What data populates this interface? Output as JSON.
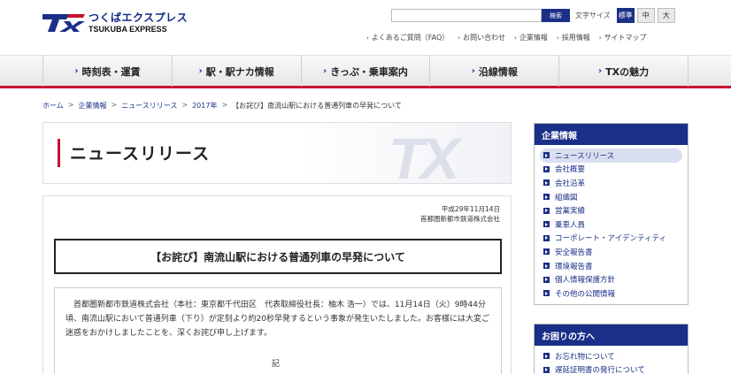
{
  "header": {
    "logo_jp": "つくばエクスプレス",
    "logo_en": "TSUKUBA EXPRESS",
    "search_placeholder": "",
    "search_button": "検索",
    "fontsize_label": "文字サイズ",
    "fontsize_options": [
      "標準",
      "中",
      "大"
    ],
    "util_links": [
      "よくあるご質問（FAQ）",
      "お問い合わせ",
      "企業情報",
      "採用情報",
      "サイトマップ"
    ]
  },
  "gnav": [
    "時刻表・運賃",
    "駅・駅ナカ情報",
    "きっぷ・乗車案内",
    "沿線情報",
    "TXの魅力"
  ],
  "breadcrumb": [
    "ホーム",
    "企業情報",
    "ニュースリリース",
    "2017年"
  ],
  "breadcrumb_current": "【お詫び】南流山駅における普通列車の早発について",
  "page_title": "ニュースリリース",
  "watermark": "TX",
  "article": {
    "date": "平成29年11月14日",
    "company": "首都圏新都市鉄道株式会社",
    "title": "【お詫び】南流山駅における普通列車の早発について",
    "body": "首都圏新都市鉄道株式会社（本社：東京都千代田区　代表取締役社長：柚木 浩一）では、11月14日（火）9時44分頃、南流山駅において普通列車（下り）が定刻より約20秒早発するという事象が発生いたしました。お客様には大変ご迷惑をおかけしましたことを、深くお詫び申し上げます。",
    "ki": "記"
  },
  "sidebar": {
    "corporate": {
      "heading": "企業情報",
      "items": [
        "ニュースリリース",
        "会社概要",
        "会社沿革",
        "組織図",
        "営業実績",
        "乗車人員",
        "コーポレート・アイデンティティ",
        "安全報告書",
        "環境報告書",
        "個人情報保護方針",
        "その他の公開情報"
      ]
    },
    "help": {
      "heading": "お困りの方へ",
      "items": [
        "お忘れ物について",
        "遅延証明書の発行について"
      ]
    }
  },
  "colors": {
    "brand_navy": "#1a2f87",
    "accent_red": "#c8102e"
  }
}
